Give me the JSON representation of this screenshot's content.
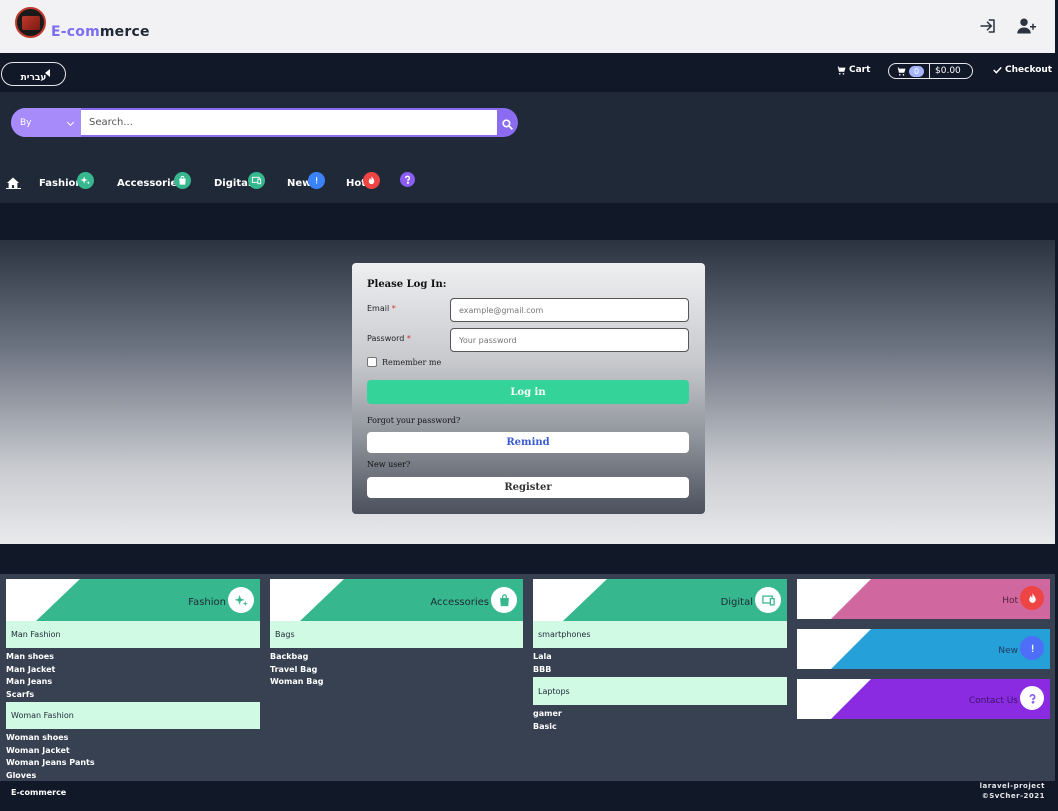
{
  "header": {
    "brand_part1": "E-com",
    "brand_part2": "merce",
    "login_icon": "sign-in-icon",
    "register_icon": "user-plus-icon"
  },
  "nav": {
    "language_label": "עברית",
    "cart_label": "Cart",
    "cart_count": "0",
    "cart_total": "$0.00",
    "checkout_label": "Checkout"
  },
  "search": {
    "by_label": "By",
    "placeholder": "Search..."
  },
  "categories_nav": [
    {
      "label": "Fashion",
      "icon": "sparkle-icon",
      "color": "#36b78d"
    },
    {
      "label": "Accessories",
      "icon": "bag-icon",
      "color": "#36b78d"
    },
    {
      "label": "Digital",
      "icon": "devices-icon",
      "color": "#36b78d"
    },
    {
      "label": "New",
      "icon": "new-badge-icon",
      "color": "#3b82f6"
    },
    {
      "label": "Hot",
      "icon": "fire-icon",
      "color": "#ef4444"
    },
    {
      "label": "",
      "icon": "question-icon",
      "color": "#8b5cf6"
    }
  ],
  "login": {
    "title": "Please Log In:",
    "email_label": "Email",
    "email_placeholder": "example@gmail.com",
    "password_label": "Password",
    "password_placeholder": "Your password",
    "required_mark": "*",
    "remember_label": "Remember me",
    "login_button": "Log in",
    "forgot_text": "Forgot your password?",
    "remind_button": "Remind",
    "new_user_text": "New user?",
    "register_button": "Register"
  },
  "footer_categories": [
    {
      "title": "Fashion",
      "groups": [
        {
          "name": "Man Fashion",
          "items": [
            "Man shoes",
            "Man Jacket",
            "Man Jeans",
            "Scarfs"
          ]
        },
        {
          "name": "Woman Fashion",
          "items": [
            "Woman shoes",
            "Woman Jacket",
            "Woman Jeans Pants",
            "Gloves"
          ]
        }
      ]
    },
    {
      "title": "Accessories",
      "groups": [
        {
          "name": "Bags",
          "items": [
            "Backbag",
            "Travel Bag",
            "Woman Bag"
          ]
        }
      ]
    },
    {
      "title": "Digital",
      "groups": [
        {
          "name": "smartphones",
          "items": [
            "Lala",
            "BBB"
          ]
        },
        {
          "name": "Laptops",
          "items": [
            "gamer",
            "Basic"
          ]
        }
      ]
    }
  ],
  "side_cards": [
    {
      "title": "Hot",
      "color": "#d0679f",
      "badge_color": "#ef4444",
      "icon": "fire-icon"
    },
    {
      "title": "New",
      "color": "#26a0d9",
      "badge_color": "#4f6ef7",
      "icon": "new-badge-icon"
    },
    {
      "title": "Contact Us",
      "color": "#8a2be2",
      "badge_color": "#8b5cf6",
      "icon": "question-icon"
    }
  ],
  "footer": {
    "brand": "E-commerce",
    "project": "laravel-project",
    "copyright": "©SvCher-2021"
  }
}
